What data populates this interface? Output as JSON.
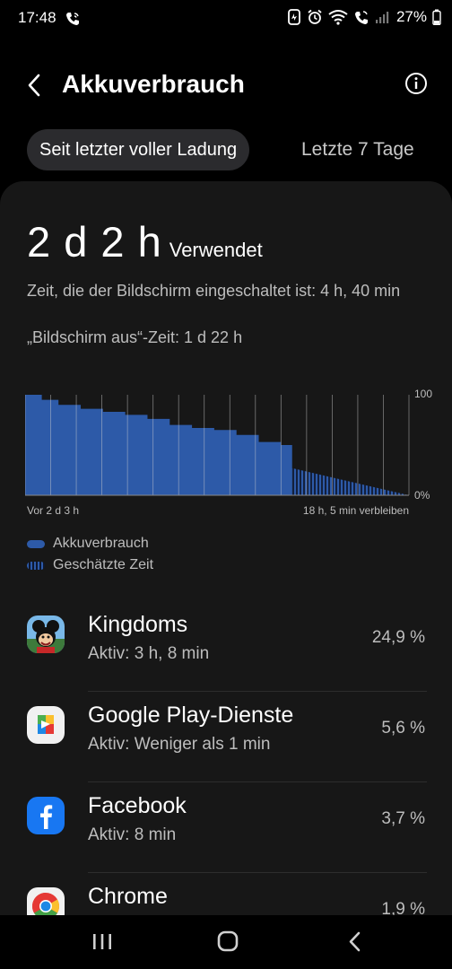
{
  "status_bar": {
    "time": "17:48",
    "battery_percent": "27%",
    "icons": [
      "wifi-call-icon",
      "battery-saver-icon",
      "alarm-icon",
      "wifi-icon",
      "signal-icon",
      "battery-icon"
    ]
  },
  "header": {
    "title": "Akkuverbrauch",
    "back_icon": "back-chevron-icon",
    "info_icon": "info-icon"
  },
  "tabs": [
    {
      "label": "Seit letzter voller Ladung",
      "active": true
    },
    {
      "label": "Letzte 7 Tage",
      "active": false
    }
  ],
  "summary": {
    "usage_time": "2 d 2 h",
    "usage_label": "Verwendet",
    "screen_on": "Zeit, die der Bildschirm eingeschaltet ist: 4 h, 40 min",
    "screen_off": "„Bildschirm aus“-Zeit: 1 d 22 h"
  },
  "chart_data": {
    "type": "area",
    "y_max_label": "100",
    "y_min_label": "0%",
    "x_start_label": "Vor 2 d 3 h",
    "x_end_label": "18 h, 5 min verbleiben",
    "ylim": [
      0,
      100
    ],
    "xlim": [
      0,
      69
    ],
    "usage_series": {
      "name": "Akkuverbrauch",
      "x": [
        0,
        3,
        6,
        10,
        14,
        18,
        22,
        26,
        30,
        34,
        38,
        42,
        46,
        48
      ],
      "y": [
        100,
        95,
        90,
        86,
        83,
        80,
        76,
        70,
        67,
        65,
        60,
        53,
        50,
        28
      ]
    },
    "estimate_series": {
      "name": "Geschätzte Zeit",
      "x": [
        48,
        69
      ],
      "y": [
        27,
        0
      ]
    },
    "colors": {
      "usage": "#2d5aa8",
      "estimate": "#2d5aa8",
      "gridline": "#cfcfcf"
    }
  },
  "legend": [
    {
      "label": "Akkuverbrauch",
      "style": "solid"
    },
    {
      "label": "Geschätzte Zeit",
      "style": "striped"
    }
  ],
  "apps": [
    {
      "name": "Kingdoms",
      "sub": "Aktiv: 3 h, 8 min",
      "percent": "24,9 %",
      "icon": "kingdoms-app-icon"
    },
    {
      "name": "Google Play-Dienste",
      "sub": "Aktiv: Weniger als 1 min",
      "percent": "5,6 %",
      "icon": "google-play-services-icon"
    },
    {
      "name": "Facebook",
      "sub": "Aktiv: 8 min",
      "percent": "3,7 %",
      "icon": "facebook-icon"
    },
    {
      "name": "Chrome",
      "sub": "",
      "percent": "1,9 %",
      "icon": "chrome-icon"
    }
  ],
  "nav": [
    "recents-icon",
    "home-icon",
    "back-icon"
  ]
}
